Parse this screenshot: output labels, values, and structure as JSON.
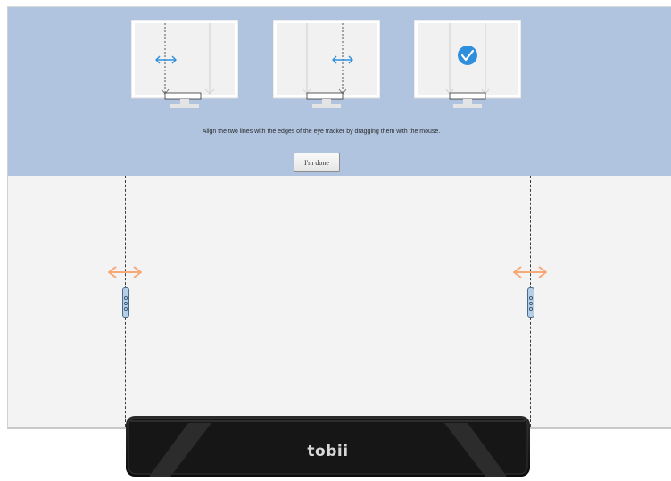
{
  "instruction_text": "Align the two lines with the edges of the eye tracker by dragging them with the mouse.",
  "done_button_label": "I'm done",
  "tracker_brand": "tobii",
  "steps": [
    {
      "icon": "adjust-left-line-step-icon"
    },
    {
      "icon": "adjust-right-line-step-icon"
    },
    {
      "icon": "aligned-check-step-icon"
    }
  ],
  "colors": {
    "panel_bg": "#b0c4e0",
    "workspace_bg": "#f3f3f3",
    "accent_blue": "#2f8fdd",
    "arrow_orange": "#f7a877",
    "handle_blue": "#b5cde6",
    "tracker_body": "#1c1c1c"
  }
}
